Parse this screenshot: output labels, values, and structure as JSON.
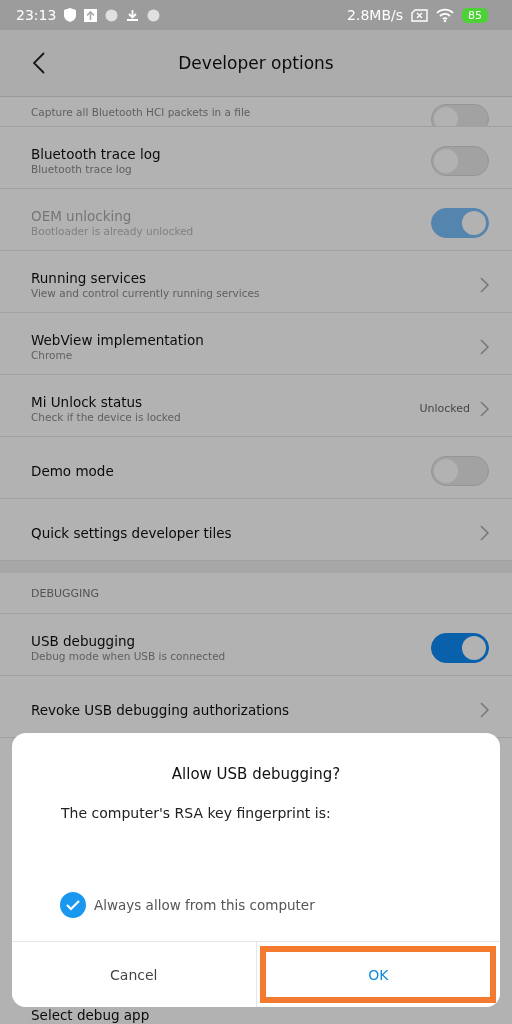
{
  "status_bar": {
    "time": "23:13",
    "speed": "2.8MB/s",
    "battery": "85"
  },
  "header": {
    "title": "Developer options"
  },
  "partial_row": {
    "subtitle": "Capture all Bluetooth HCI packets in a file",
    "on": false
  },
  "rows": [
    {
      "kind": "toggle",
      "title": "Bluetooth trace log",
      "subtitle": "Bluetooth trace log",
      "on": false,
      "disabled": false
    },
    {
      "kind": "toggle",
      "title": "OEM unlocking",
      "subtitle": "Bootloader is already unlocked",
      "on": true,
      "disabled": true
    },
    {
      "kind": "link",
      "title": "Running services",
      "subtitle": "View and control currently running services"
    },
    {
      "kind": "link",
      "title": "WebView implementation",
      "subtitle": "Chrome"
    },
    {
      "kind": "link",
      "title": "Mi Unlock status",
      "subtitle": "Check if the device is locked",
      "value": "Unlocked"
    },
    {
      "kind": "toggle",
      "title": "Demo mode",
      "on": false,
      "disabled": false
    },
    {
      "kind": "link",
      "title": "Quick settings developer tiles"
    }
  ],
  "debugging": {
    "heading": "DEBUGGING",
    "rows": [
      {
        "kind": "toggle",
        "title": "USB debugging",
        "subtitle": "Debug mode when USB is connected",
        "on": true,
        "disabled": false
      },
      {
        "kind": "link",
        "title": "Revoke USB debugging authorizations"
      }
    ]
  },
  "bottom_row": {
    "title": "Select debug app"
  },
  "dialog": {
    "title": "Allow USB debugging?",
    "message": "The computer's RSA key fingerprint is:",
    "checkbox": {
      "label": "Always allow from this computer",
      "checked": true
    },
    "buttons": [
      {
        "label": "Cancel",
        "highlighted": false
      },
      {
        "label": "OK",
        "highlighted": true
      }
    ]
  }
}
